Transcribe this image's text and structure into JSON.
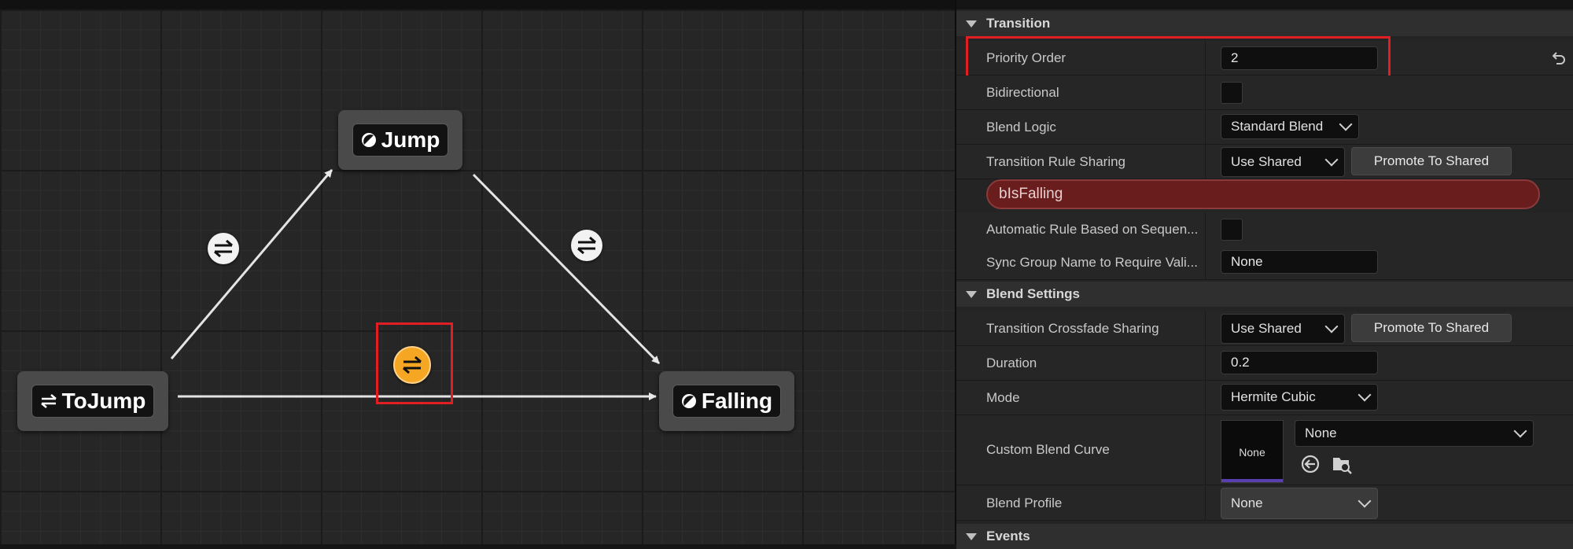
{
  "graph": {
    "states": [
      {
        "id": "jump",
        "label": "Jump",
        "icon": "state-icon"
      },
      {
        "id": "tojump",
        "label": "ToJump",
        "icon": "conduit-icon"
      },
      {
        "id": "falling",
        "label": "Falling",
        "icon": "state-icon"
      }
    ],
    "transitions": [
      {
        "from": "tojump",
        "to": "jump",
        "selected": false,
        "icon": "transition-rule-icon"
      },
      {
        "from": "jump",
        "to": "falling",
        "selected": false,
        "icon": "transition-rule-icon"
      },
      {
        "from": "tojump",
        "to": "falling",
        "selected": true,
        "icon": "transition-rule-icon"
      }
    ]
  },
  "details": {
    "transition_section": {
      "title": "Transition",
      "priority_order": {
        "label": "Priority Order",
        "value": "2"
      },
      "bidirectional": {
        "label": "Bidirectional",
        "checked": false
      },
      "blend_logic": {
        "label": "Blend Logic",
        "value": "Standard Blend"
      },
      "rule_sharing": {
        "label": "Transition Rule Sharing",
        "value": "Use Shared",
        "button": "Promote To Shared"
      },
      "rule_variable": "bIsFalling",
      "auto_rule": {
        "label": "Automatic Rule Based on Sequen...",
        "checked": false
      },
      "sync_group": {
        "label": "Sync Group Name to Require Vali...",
        "value": "None"
      }
    },
    "blend_section": {
      "title": "Blend Settings",
      "crossfade_sharing": {
        "label": "Transition Crossfade Sharing",
        "value": "Use Shared",
        "button": "Promote To Shared"
      },
      "duration": {
        "label": "Duration",
        "value": "0.2"
      },
      "mode": {
        "label": "Mode",
        "value": "Hermite Cubic"
      },
      "custom_curve": {
        "label": "Custom Blend Curve",
        "thumbnail": "None",
        "value": "None"
      },
      "blend_profile": {
        "label": "Blend Profile",
        "value": "None"
      }
    },
    "events_section": {
      "title": "Events"
    }
  },
  "colors": {
    "highlight_box": "#e01e24",
    "selected_transition": "#f5a623",
    "rule_pill": "#6a1d1d"
  }
}
